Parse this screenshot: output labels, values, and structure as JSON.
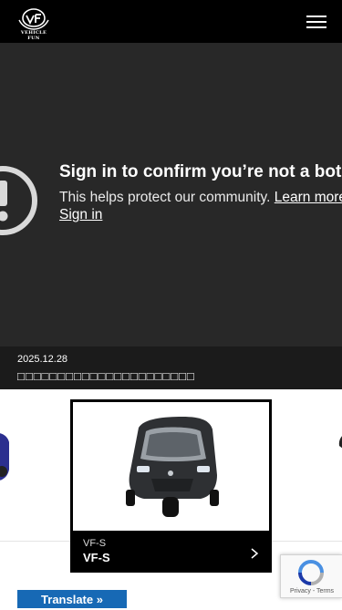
{
  "header": {
    "logo_text": "VEHICLE FUN",
    "menu_icon": "hamburger-menu-icon"
  },
  "video": {
    "title": "Sign in to confirm you’re not a bot",
    "message": "This helps protect our community.",
    "learn_more": "Learn more",
    "sign_in": "Sign in",
    "icon": "alert-circle-icon"
  },
  "news": {
    "date": "2025.12.28",
    "title": "□□□□□□□□□□□□□□□□□□□□□□"
  },
  "product": {
    "subtitle": "VF-S",
    "name": "VF-S",
    "arrow_icon": "chevron-right-icon"
  },
  "recaptcha": {
    "privacy": "Privacy",
    "separator": " - ",
    "terms": "Terms"
  },
  "translate": {
    "label": "Translate »"
  },
  "colors": {
    "header_bg": "#000000",
    "video_bg": "#282828",
    "news_bg": "#1b1b1b",
    "translate_bg": "#1769b5"
  }
}
